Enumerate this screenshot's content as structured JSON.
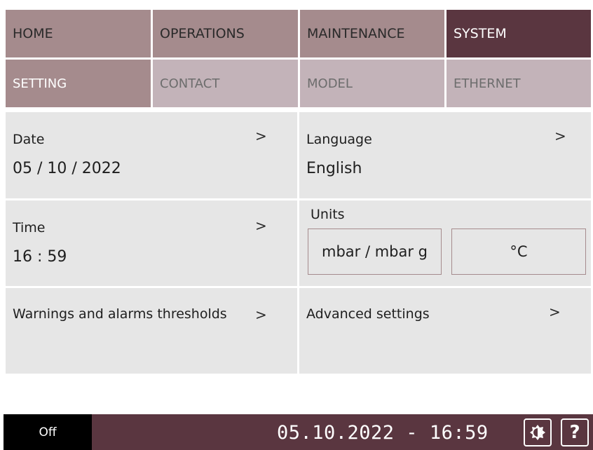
{
  "nav": {
    "tabs": [
      {
        "label": "HOME"
      },
      {
        "label": "OPERATIONS"
      },
      {
        "label": "MAINTENANCE"
      },
      {
        "label": "SYSTEM"
      }
    ],
    "active": "SYSTEM"
  },
  "subnav": {
    "tabs": [
      {
        "label": "SETTING"
      },
      {
        "label": "CONTACT"
      },
      {
        "label": "MODEL"
      },
      {
        "label": "ETHERNET"
      }
    ],
    "active": "SETTING"
  },
  "settings": {
    "date": {
      "label": "Date",
      "value": "05 / 10 / 2022"
    },
    "language": {
      "label": "Language",
      "value": "English"
    },
    "time": {
      "label": "Time",
      "value": "16 : 59"
    },
    "units": {
      "label": "Units",
      "pressure": "mbar / mbar g",
      "temperature": "°C"
    },
    "thresholds": {
      "label": "Warnings and alarms thresholds"
    },
    "advanced": {
      "label": "Advanced settings"
    },
    "chevron": ">"
  },
  "status_bar": {
    "mode": "Off",
    "datetime": "05.10.2022 - 16:59",
    "icons": [
      "brightness-icon",
      "help-icon"
    ],
    "help_glyph": "?"
  },
  "colors": {
    "nav_bg": "#a58b8d",
    "nav_active": "#5a3640",
    "subnav_bg": "#c3b3b9",
    "panel_bg": "#e6e6e6",
    "status_bg": "#5a3640"
  }
}
